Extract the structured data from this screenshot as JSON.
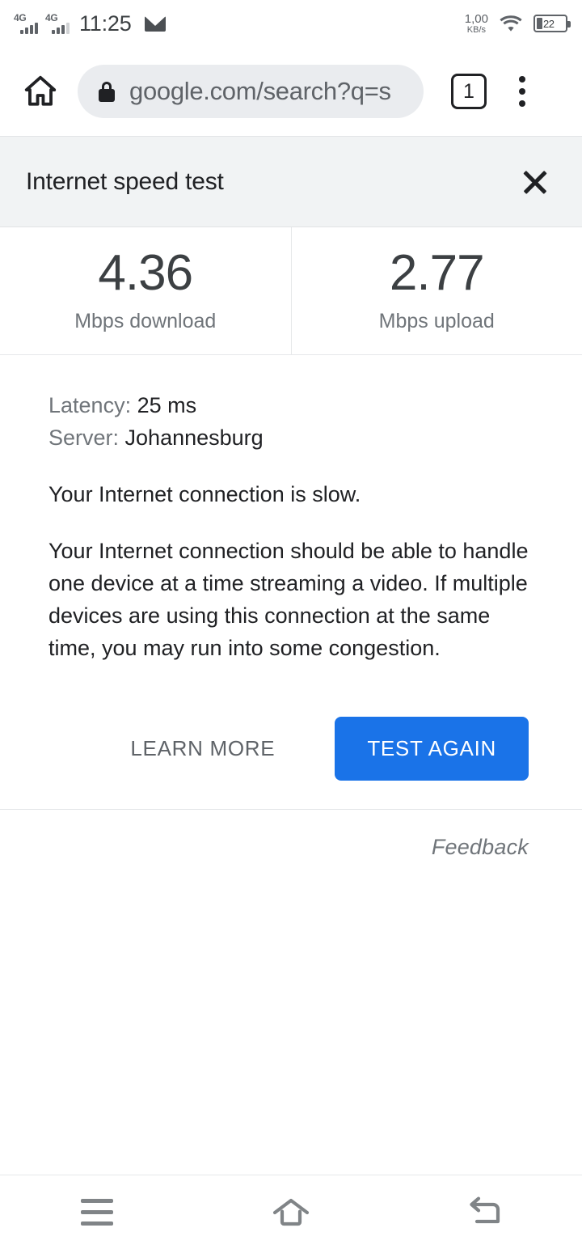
{
  "statusbar": {
    "network_type_1": "4G",
    "network_type_2": "4G",
    "time": "11:25",
    "mail_icon": "mail-icon",
    "netspeed_value": "1,00",
    "netspeed_unit": "KB/s",
    "wifi_icon": "wifi-icon",
    "battery_level": "22"
  },
  "browser": {
    "home_icon": "home-icon",
    "lock_icon": "lock-icon",
    "url": "google.com/search?q=s",
    "tab_count": "1",
    "menu_icon": "overflow-menu-icon"
  },
  "panel": {
    "title": "Internet speed test",
    "close_icon": "close-icon",
    "results": [
      {
        "value": "4.36",
        "label": "Mbps download"
      },
      {
        "value": "2.77",
        "label": "Mbps upload"
      }
    ],
    "latency_key": "Latency: ",
    "latency_value": "25 ms",
    "server_key": "Server: ",
    "server_value": "Johannesburg",
    "summary": "Your Internet connection is slow.",
    "description": "Your Internet connection should be able to handle one device at a time streaming a video. If multiple devices are using this connection at the same time, you may run into some congestion.",
    "learn_more_label": "LEARN MORE",
    "test_again_label": "TEST AGAIN",
    "feedback_label": "Feedback",
    "accent_color": "#1a73e8",
    "header_bg": "#f1f3f4"
  },
  "navbar": {
    "recents_icon": "recents-menu-icon",
    "home_icon": "home-outline-icon",
    "back_icon": "back-arrow-icon"
  }
}
